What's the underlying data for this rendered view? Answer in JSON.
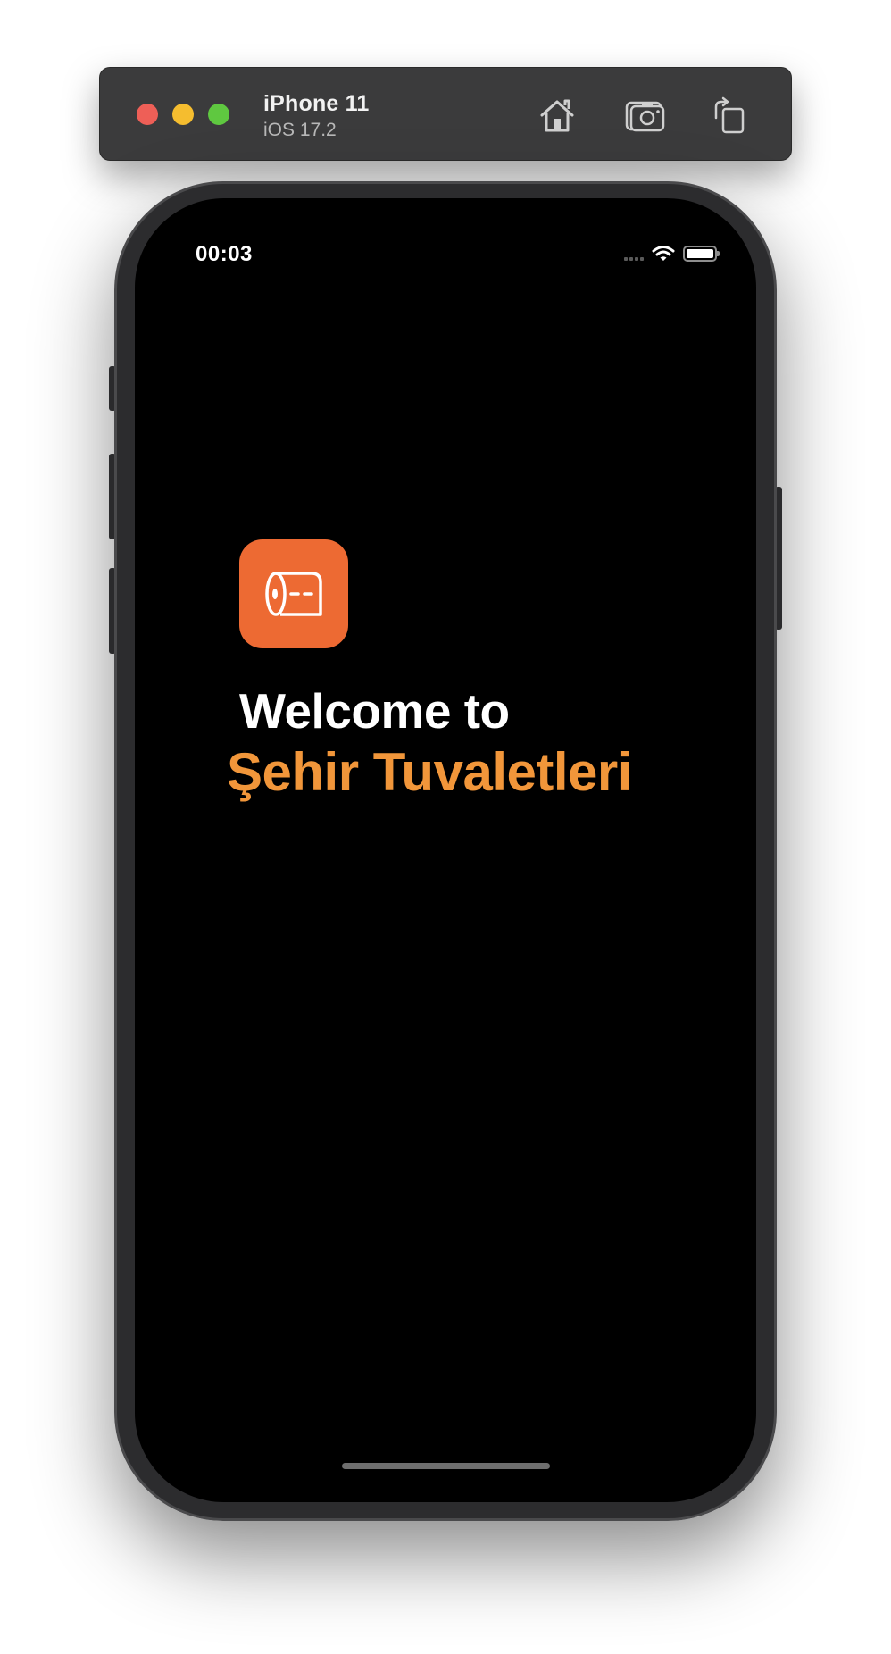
{
  "simulator": {
    "device_name": "iPhone 11",
    "os_version": "iOS 17.2",
    "traffic_lights": {
      "close_color": "#ee5f57",
      "minimize_color": "#f5bd2f",
      "zoom_color": "#5fc840"
    },
    "toolbar_icons": [
      "home-icon",
      "screenshot-icon",
      "rotate-icon"
    ]
  },
  "status_bar": {
    "time": "00:03",
    "icons": [
      "cellular-signal-icon",
      "wifi-icon",
      "battery-icon"
    ]
  },
  "app": {
    "icon": "toilet-paper-icon",
    "icon_background": "#ed6a33",
    "welcome_text": "Welcome to",
    "app_name": "Şehir Tuvaletleri",
    "app_name_color": "#f1963a"
  }
}
